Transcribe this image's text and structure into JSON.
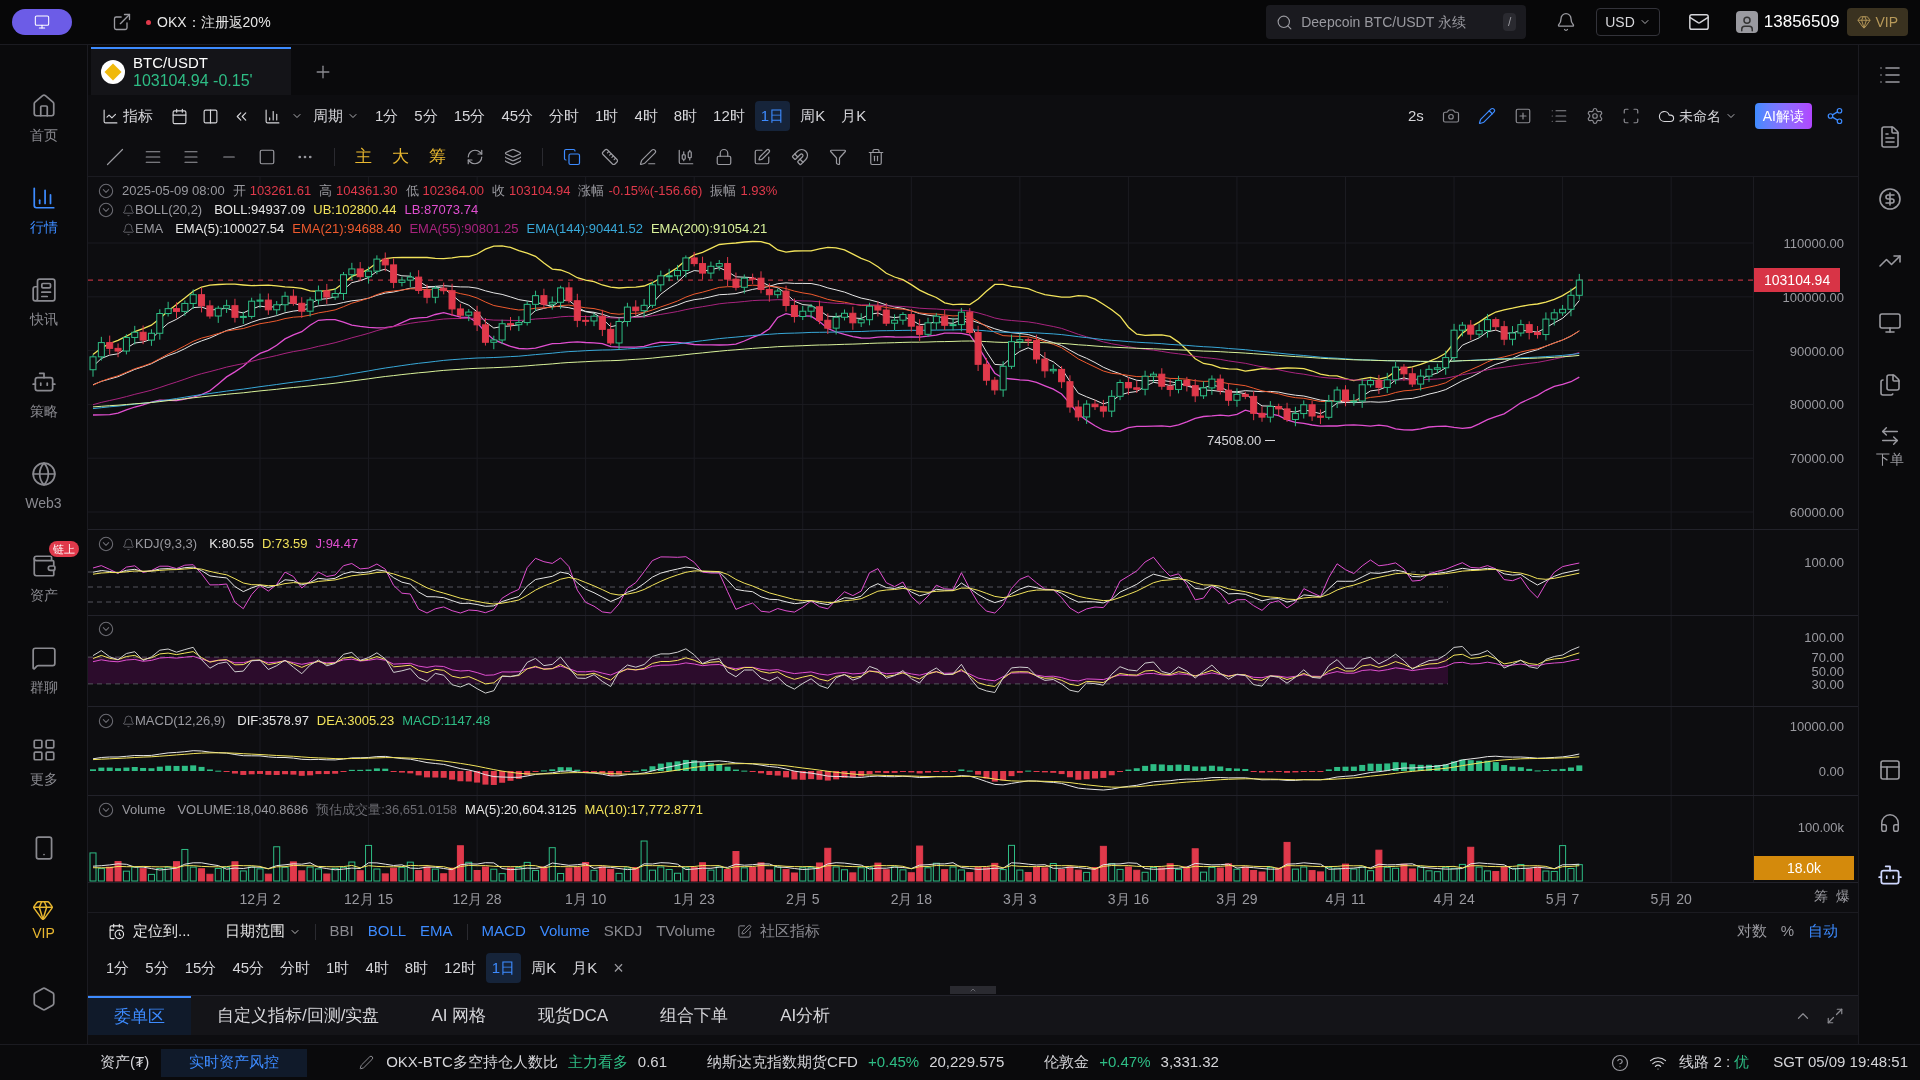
{
  "top_bar": {
    "promo": "OKX：注册返20%",
    "search_placeholder": "Deepcoin BTC/USDT 永续",
    "search_key": "/",
    "currency": "USD",
    "account": "13856509",
    "vip": "VIP"
  },
  "sidebar": {
    "items": [
      {
        "label": "首页",
        "selected": false
      },
      {
        "label": "行情",
        "selected": true
      },
      {
        "label": "快讯",
        "selected": false
      },
      {
        "label": "策略",
        "selected": false
      },
      {
        "label": "Web3",
        "selected": false
      },
      {
        "label": "资产",
        "selected": false,
        "badge": "链上"
      },
      {
        "label": "群聊",
        "selected": false
      },
      {
        "label": "更多",
        "selected": false
      }
    ],
    "vip": "VIP"
  },
  "symbol_tab": {
    "symbol": "BTC/USDT",
    "price": "103104.94",
    "change": "-0.15'"
  },
  "period_toolbar": {
    "indicator_label": "指标",
    "period_label": "周期",
    "periods": [
      {
        "label": "1分",
        "selected": false
      },
      {
        "label": "5分",
        "selected": false
      },
      {
        "label": "15分",
        "selected": false
      },
      {
        "label": "45分",
        "selected": false
      },
      {
        "label": "分时",
        "selected": false
      },
      {
        "label": "1时",
        "selected": false
      },
      {
        "label": "4时",
        "selected": false
      },
      {
        "label": "8时",
        "selected": false
      },
      {
        "label": "12时",
        "selected": false
      },
      {
        "label": "1日",
        "selected": true
      },
      {
        "label": "周K",
        "selected": false
      },
      {
        "label": "月K",
        "selected": false
      }
    ],
    "refresh": "2s",
    "layout_name": "未命名",
    "ai_button": "AI解读"
  },
  "drawing_toolbar": {
    "text_tools": [
      "主",
      "大",
      "筹"
    ]
  },
  "ohlc": {
    "datetime": "2025-05-09 08:00",
    "fields": [
      {
        "label": "开",
        "value": "103261.61"
      },
      {
        "label": "高",
        "value": "104361.30"
      },
      {
        "label": "低",
        "value": "102364.00"
      },
      {
        "label": "收",
        "value": "103104.94"
      },
      {
        "label": "涨幅",
        "value": "-0.15%(-156.66)"
      },
      {
        "label": "振幅",
        "value": "1.93%"
      }
    ]
  },
  "main_indicators": [
    {
      "name": "BOLL(20,2)",
      "alert": true,
      "collapsible": true,
      "values": [
        {
          "text": "BOLL:94937.09",
          "color": "#e6e6e6"
        },
        {
          "text": "UB:102800.44",
          "color": "#f2e35b"
        },
        {
          "text": "LB:87073.74",
          "color": "#e04fd0"
        }
      ]
    },
    {
      "name": "EMA",
      "alert": true,
      "collapsible": false,
      "values": [
        {
          "text": "EMA(5):100027.54",
          "color": "#e6e6e6"
        },
        {
          "text": "EMA(21):94688.40",
          "color": "#ee5a2e"
        },
        {
          "text": "EMA(55):90801.25",
          "color": "#a8237e"
        },
        {
          "text": "EMA(144):90441.52",
          "color": "#38a8d8"
        },
        {
          "text": "EMA(200):91054.21",
          "color": "#d9f29a"
        }
      ]
    }
  ],
  "price_axis": {
    "labels": [
      "110000.00",
      "100000.00",
      "90000.00",
      "80000.00",
      "70000.00",
      "60000.00"
    ],
    "current_price": "103104.94",
    "low_marker": "74508.00"
  },
  "kdj": {
    "name": "KDJ(9,3,3)",
    "alert": true,
    "collapsible": true,
    "values": [
      {
        "text": "K:80.55",
        "color": "#e6e6e6"
      },
      {
        "text": "D:73.59",
        "color": "#f2e35b"
      },
      {
        "text": "J:94.47",
        "color": "#e04fd0"
      }
    ],
    "axis": [
      "100.00"
    ]
  },
  "oscillator": {
    "collapsible": true,
    "axis": [
      "100.00",
      "70.00",
      "50.00",
      "30.00"
    ]
  },
  "macd": {
    "name": "MACD(12,26,9)",
    "alert": true,
    "collapsible": true,
    "values": [
      {
        "text": "DIF:3578.97",
        "color": "#e6e6e6"
      },
      {
        "text": "DEA:3005.23",
        "color": "#f2e35b"
      },
      {
        "text": "MACD:1147.48",
        "color": "#2ebd85"
      }
    ],
    "axis": [
      "10000.00",
      "0.00"
    ]
  },
  "volume": {
    "name": "Volume",
    "alert": false,
    "collapsible": true,
    "values": [
      {
        "text": "VOLUME:18,040.8686",
        "color": "#9a9aa0"
      },
      {
        "text": "预估成交量:36,651.0158",
        "color": "#6b6b72"
      },
      {
        "text": "MA(5):20,604.3125",
        "color": "#e6e6e6"
      },
      {
        "text": "MA(10):17,772.8771",
        "color": "#f2e35b"
      }
    ],
    "axis": [
      "100.00k"
    ],
    "current": "18.0k"
  },
  "date_axis": {
    "labels": [
      "12月 2",
      "12月 15",
      "12月 28",
      "1月 10",
      "1月 23",
      "2月 5",
      "2月 18",
      "3月 3",
      "3月 16",
      "3月 29",
      "4月 11",
      "4月 24",
      "5月 7",
      "5月 20"
    ],
    "corner": [
      "筹",
      "爆"
    ]
  },
  "indicator_bar": {
    "locate": "定位到...",
    "range": "日期范围",
    "main": [
      {
        "label": "BBI",
        "selected": false
      },
      {
        "label": "BOLL",
        "selected": true
      },
      {
        "label": "EMA",
        "selected": true
      }
    ],
    "sub": [
      {
        "label": "MACD",
        "selected": true
      },
      {
        "label": "Volume",
        "selected": true
      },
      {
        "label": "SKDJ",
        "selected": false
      },
      {
        "label": "TVolume",
        "selected": false
      }
    ],
    "community": "社区指标",
    "scale": [
      {
        "label": "对数",
        "selected": false
      },
      {
        "label": "%",
        "selected": false
      },
      {
        "label": "自动",
        "selected": true
      }
    ]
  },
  "period_row": {
    "periods": [
      {
        "label": "1分",
        "selected": false
      },
      {
        "label": "5分",
        "selected": false
      },
      {
        "label": "15分",
        "selected": false
      },
      {
        "label": "45分",
        "selected": false
      },
      {
        "label": "分时",
        "selected": false
      },
      {
        "label": "1时",
        "selected": false
      },
      {
        "label": "4时",
        "selected": false
      },
      {
        "label": "8时",
        "selected": false
      },
      {
        "label": "12时",
        "selected": false
      },
      {
        "label": "1日",
        "selected": true
      },
      {
        "label": "周K",
        "selected": false
      },
      {
        "label": "月K",
        "selected": false
      }
    ],
    "close": "×"
  },
  "bottom_tabs": [
    {
      "label": "委单区",
      "selected": true
    },
    {
      "label": "自定义指标/回测/实盘",
      "selected": false
    },
    {
      "label": "AI 网格",
      "selected": false
    },
    {
      "label": "现货DCA",
      "selected": false
    },
    {
      "label": "组合下单",
      "selected": false
    },
    {
      "label": "AI分析",
      "selected": false
    }
  ],
  "right_sidebar": {
    "order_label": "下单"
  },
  "status_bar": {
    "assets": "资产(₮)",
    "risk": "实时资产风控",
    "tickers": [
      {
        "name": "OKX-BTC多空持仓人数比",
        "change": "主力看多",
        "value": "0.61"
      },
      {
        "name": "纳斯达克指数期货CFD",
        "change": "+0.45%",
        "value": "20,229.575"
      },
      {
        "name": "伦敦金",
        "change": "+0.47%",
        "value": "3,331.32"
      }
    ],
    "line": "线路 2 :",
    "line_quality": "优",
    "time": "SGT 05/09 19:48:51"
  }
}
